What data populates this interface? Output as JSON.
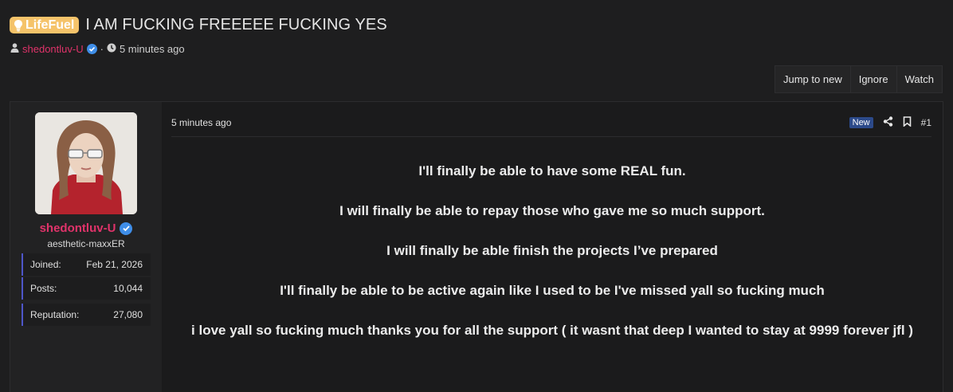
{
  "thread": {
    "prefix": "LifeFuel",
    "title": "I AM FUCKING FREEEEE FUCKING YES",
    "author": "shedontluv-U",
    "separator": "·",
    "posted": "5 minutes ago"
  },
  "actions": {
    "jump": "Jump to new",
    "ignore": "Ignore",
    "watch": "Watch"
  },
  "user": {
    "name": "shedontluv-U",
    "title": "aesthetic-maxxER",
    "stats": [
      {
        "label": "Joined:",
        "value": "Feb 21, 2026"
      },
      {
        "label": "Posts:",
        "value": "10,044"
      },
      {
        "label": "Reputation:",
        "value": "27,080"
      }
    ]
  },
  "post": {
    "date": "5 minutes ago",
    "new_badge": "New",
    "number": "#1",
    "paragraphs": [
      "I'll finally be able to have some REAL fun.",
      "I will finally be able to repay those who gave me so much support.",
      "I will finally be able finish the projects I’ve prepared",
      "I'll finally be able to be active again like I used to be I've missed yall so fucking much",
      "i love yall so fucking much thanks you for all the support ( it wasnt that deep I wanted to stay at 9999 forever jfl )"
    ]
  },
  "colors": {
    "accent_author": "#e0336a",
    "prefix_bg": "#f5c36a",
    "verified": "#3f8ee8",
    "new_badge": "#2c4a8a",
    "stat_border": "#4e56c9"
  },
  "icons": [
    "lightbulb-icon",
    "user-icon",
    "verified-icon",
    "clock-icon",
    "share-icon",
    "bookmark-icon"
  ]
}
